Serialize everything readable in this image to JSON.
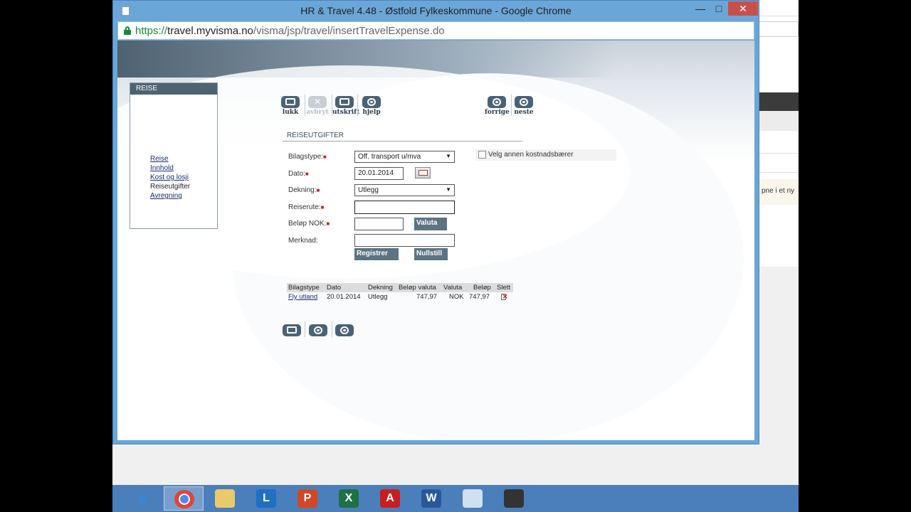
{
  "window": {
    "title": "HR & Travel 4.48 - Østfold Fylkeskommune - Google Chrome",
    "minimize": "—",
    "maximize": "□",
    "close": "✕"
  },
  "address": {
    "scheme": "https://",
    "host": "travel.myvisma.no",
    "path": "/visma/jsp/travel/insertTravelExpense.do"
  },
  "sidebar": {
    "header": "REISE",
    "items": [
      {
        "label": "Reise",
        "current": false
      },
      {
        "label": "Innhold",
        "current": false
      },
      {
        "label": "Kost og losji",
        "current": false
      },
      {
        "label": "Reiseutgifter",
        "current": true
      },
      {
        "label": "Avregning",
        "current": false
      }
    ]
  },
  "toolbar": {
    "lukk": "lukk",
    "avbryt": "avbryt",
    "utskrift": "utskrift",
    "hjelp": "hjelp",
    "forrige": "forrige",
    "neste": "neste"
  },
  "section_title": "REISEUTGIFTER",
  "form": {
    "bilagstype_label": "Bilagstype:",
    "bilagstype_value": "Off. transport u/mva",
    "dato_label": "Dato:",
    "dato_value": "20.01.2014",
    "dekning_label": "Dekning:",
    "dekning_value": "Utlegg",
    "reiserute_label": "Reiserute:",
    "reiserute_value": "",
    "belop_label": "Beløp NOK:",
    "belop_value": "",
    "valuta_button": "Valuta",
    "merknad_label": "Merknad:",
    "merknad_value": "",
    "registrer_button": "Registrer",
    "nullstill_button": "Nullstill",
    "required_mark": "■",
    "annen_kostnadsbaerer": "Velg annen kostnadsbærer"
  },
  "table": {
    "headers": [
      "Bilagstype",
      "Dato",
      "Dekning",
      "Beløp valuta",
      "Valuta",
      "Beløp",
      "Slett"
    ],
    "rows": [
      [
        "Fly utland",
        "20.01.2014",
        "Utlegg",
        "747,97",
        "NOK",
        "747,97"
      ]
    ]
  },
  "background_window": {
    "note": "pne i et ny"
  },
  "taskbar": {
    "apps": [
      "internet-explorer",
      "chrome",
      "file-explorer",
      "lync",
      "powerpoint",
      "excel",
      "acrobat",
      "word",
      "notepad",
      "projector"
    ]
  }
}
